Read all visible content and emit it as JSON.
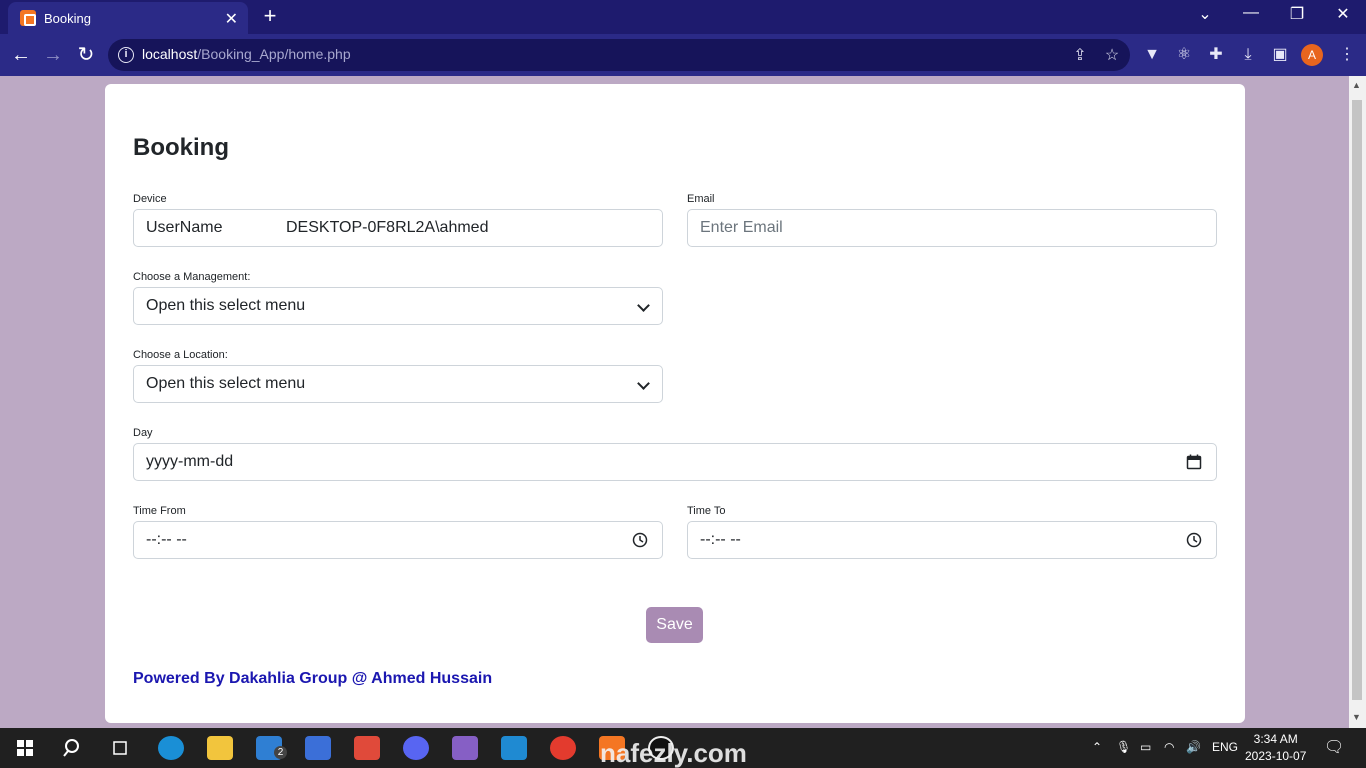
{
  "browser": {
    "tab_title": "Booking",
    "tab_close": "✕",
    "new_tab": "+",
    "url_host": "localhost",
    "url_path": "/Booking_App/home.php",
    "profile_initial": "A",
    "win_minimize": "—",
    "win_restore": "❐",
    "win_close": "✕",
    "tab_search": "⌄"
  },
  "form": {
    "title": "Booking",
    "device_label": "Device",
    "device_prefix": "UserName",
    "device_value": "DESKTOP-0F8RL2A\\ahmed",
    "email_label": "Email",
    "email_placeholder": "Enter Email",
    "management_label": "Choose a Management:",
    "management_selected": "Open this select menu",
    "location_label": "Choose a Location:",
    "location_selected": "Open this select menu",
    "day_label": "Day",
    "day_placeholder": "yyyy-mm-dd",
    "time_from_label": "Time From",
    "time_from_placeholder": "--:-- --",
    "time_to_label": "Time To",
    "time_to_placeholder": "--:-- --",
    "save_label": "Save",
    "footer": "Powered By Dakahlia Group @ Ahmed Hussain"
  },
  "taskbar": {
    "lang": "ENG",
    "time": "3:34 AM",
    "date": "2023-10-07",
    "badge": "2"
  },
  "watermark": "nafezly.com",
  "colors": {
    "page_bg": "#bca9c4",
    "browser_frame": "#2b2a87",
    "save_button": "#a98bb3",
    "footer_text": "#1b17b0"
  }
}
